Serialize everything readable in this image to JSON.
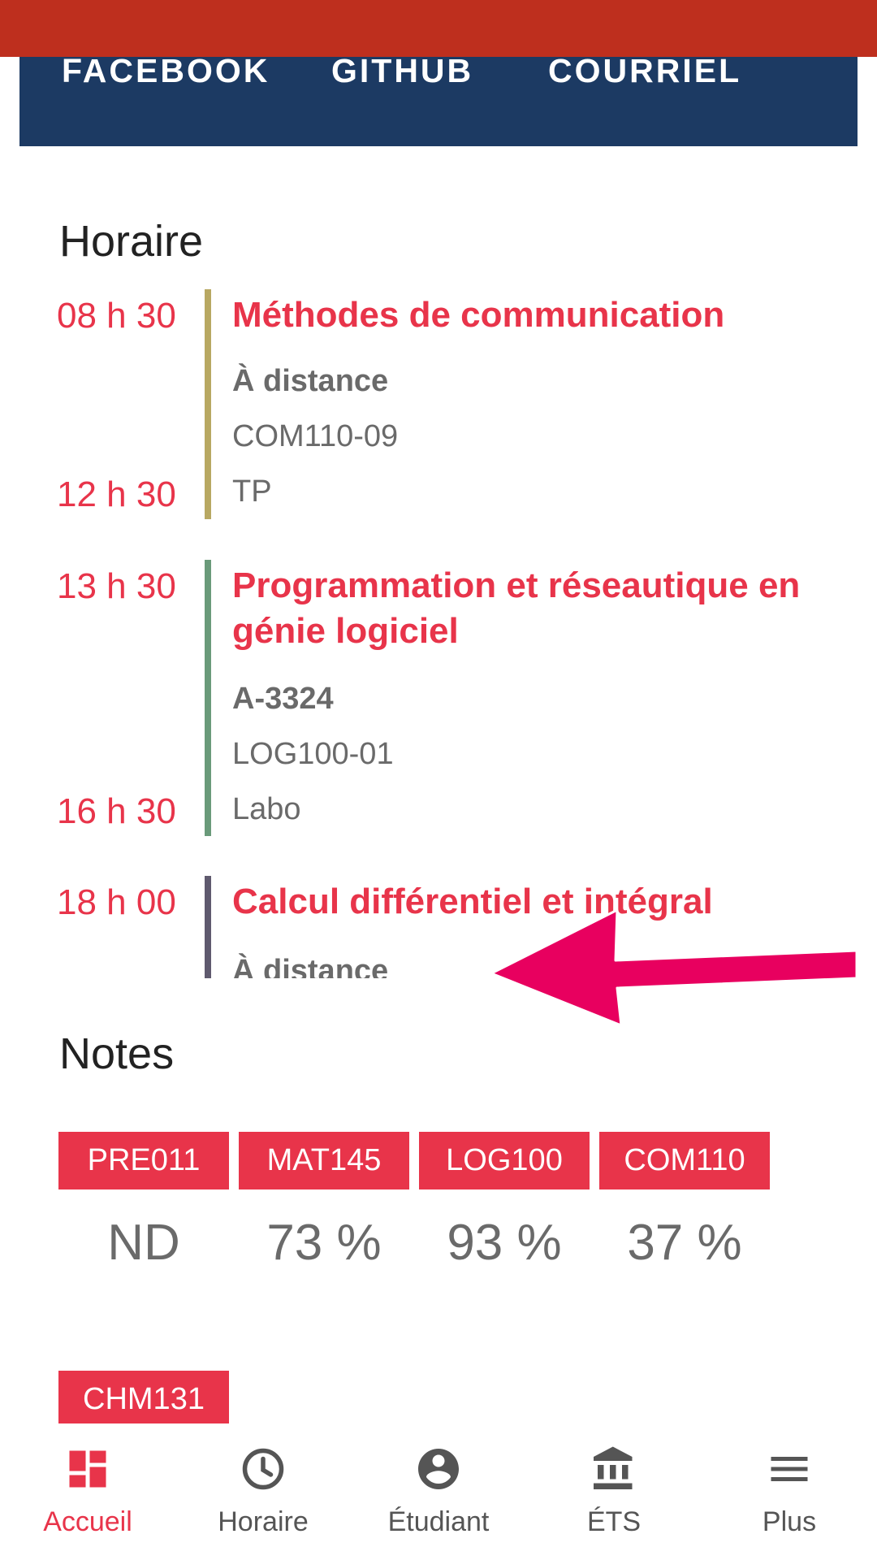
{
  "social": {
    "links": [
      "FACEBOOK",
      "GITHUB",
      "COURRIEL"
    ]
  },
  "schedule": {
    "title": "Horaire",
    "courses": [
      {
        "start": "08 h 30",
        "end": "12 h 30",
        "title": "Méthodes de communication",
        "location": "À distance",
        "code": "COM110-09",
        "type": "TP",
        "color": "#b8a862"
      },
      {
        "start": "13 h 30",
        "end": "16 h 30",
        "title": "Programmation et réseautique en génie logiciel",
        "location": "A-3324",
        "code": "LOG100-01",
        "type": "Labo",
        "color": "#6a9a7a"
      },
      {
        "start": "18 h 00",
        "title": "Calcul différentiel et intégral",
        "location": "À distance",
        "color": "#5f5a6e"
      }
    ]
  },
  "grades": {
    "title": "Notes",
    "items": [
      {
        "code": "PRE011",
        "value": "ND"
      },
      {
        "code": "MAT145",
        "value": "73 %"
      },
      {
        "code": "LOG100",
        "value": "93 %"
      },
      {
        "code": "COM110",
        "value": "37 %"
      }
    ],
    "next": [
      {
        "code": "CHM131"
      }
    ]
  },
  "nav": {
    "items": [
      {
        "label": "Accueil",
        "icon": "dashboard-icon",
        "active": true
      },
      {
        "label": "Horaire",
        "icon": "clock-icon"
      },
      {
        "label": "Étudiant",
        "icon": "account-circle-icon"
      },
      {
        "label": "ÉTS",
        "icon": "institution-icon"
      },
      {
        "label": "Plus",
        "icon": "menu-icon"
      }
    ]
  },
  "colors": {
    "accent": "#e8344a",
    "header": "#be2f1e",
    "card": "#1c3a63",
    "annotation_arrow": "#e8005f"
  }
}
